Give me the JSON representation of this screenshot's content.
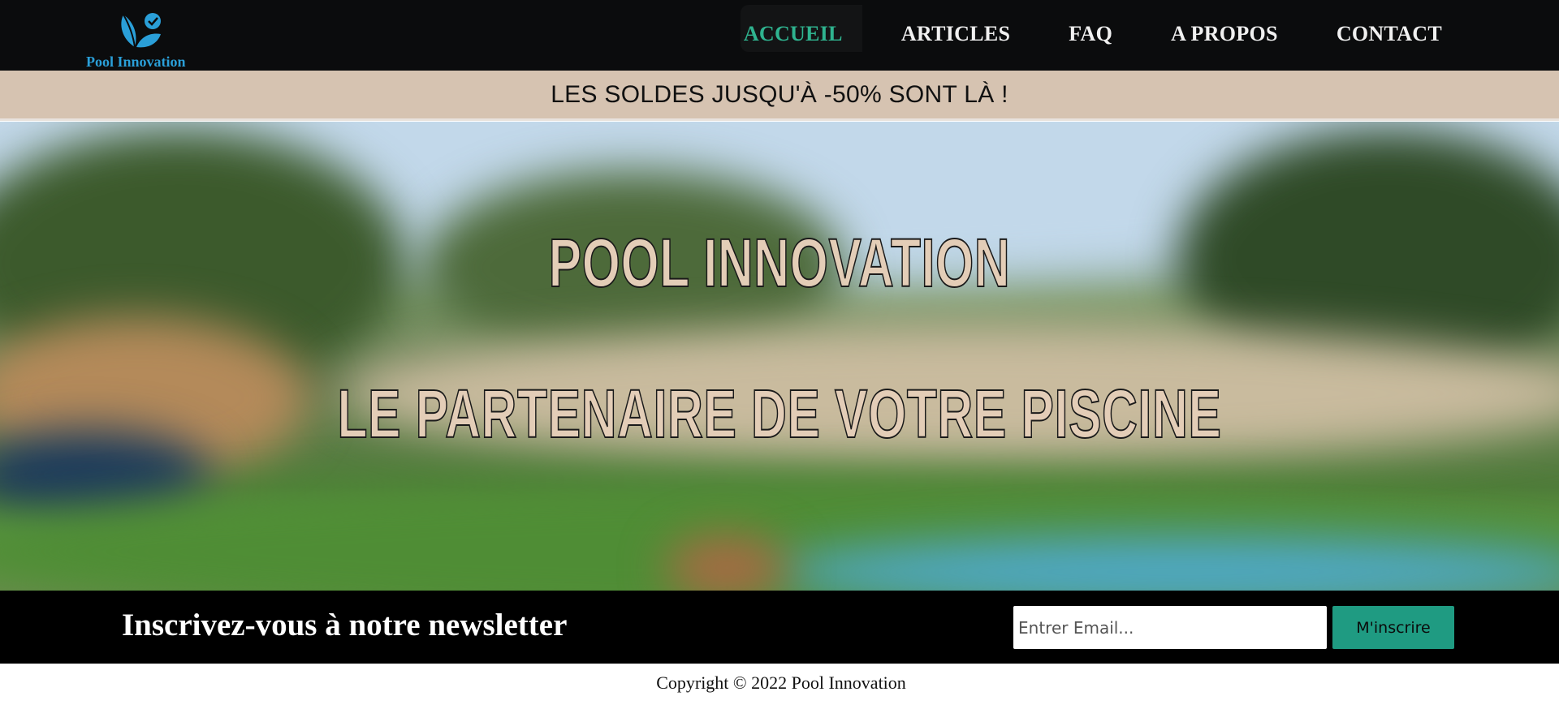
{
  "header": {
    "logo_text": "Pool Innovation",
    "nav": [
      {
        "label": "ACCUEIL",
        "active": true
      },
      {
        "label": "ARTICLES",
        "active": false
      },
      {
        "label": "FAQ",
        "active": false
      },
      {
        "label": "A PROPOS",
        "active": false
      },
      {
        "label": "CONTACT",
        "active": false
      }
    ]
  },
  "promo": {
    "text": "LES SOLDES JUSQU'À -50% SONT LÀ !"
  },
  "hero": {
    "title": "POOL INNOVATION",
    "subtitle": "LE PARTENAIRE DE VOTRE PISCINE"
  },
  "newsletter": {
    "title": "Inscrivez-vous à notre newsletter",
    "email_placeholder": "Entrer Email...",
    "email_value": "",
    "button_label": "M'inscrire"
  },
  "footer": {
    "copyright": "Copyright © 2022 Pool Innovation"
  },
  "colors": {
    "header_bg": "#0b0c0d",
    "nav_active": "#2fb38f",
    "logo_blue": "#2a9fd8",
    "promo_bg": "#d6c3b1",
    "hero_text": "#e3cdb7",
    "button_bg": "#1f9b82"
  },
  "icons": {
    "logo": "leaf-check-icon"
  }
}
